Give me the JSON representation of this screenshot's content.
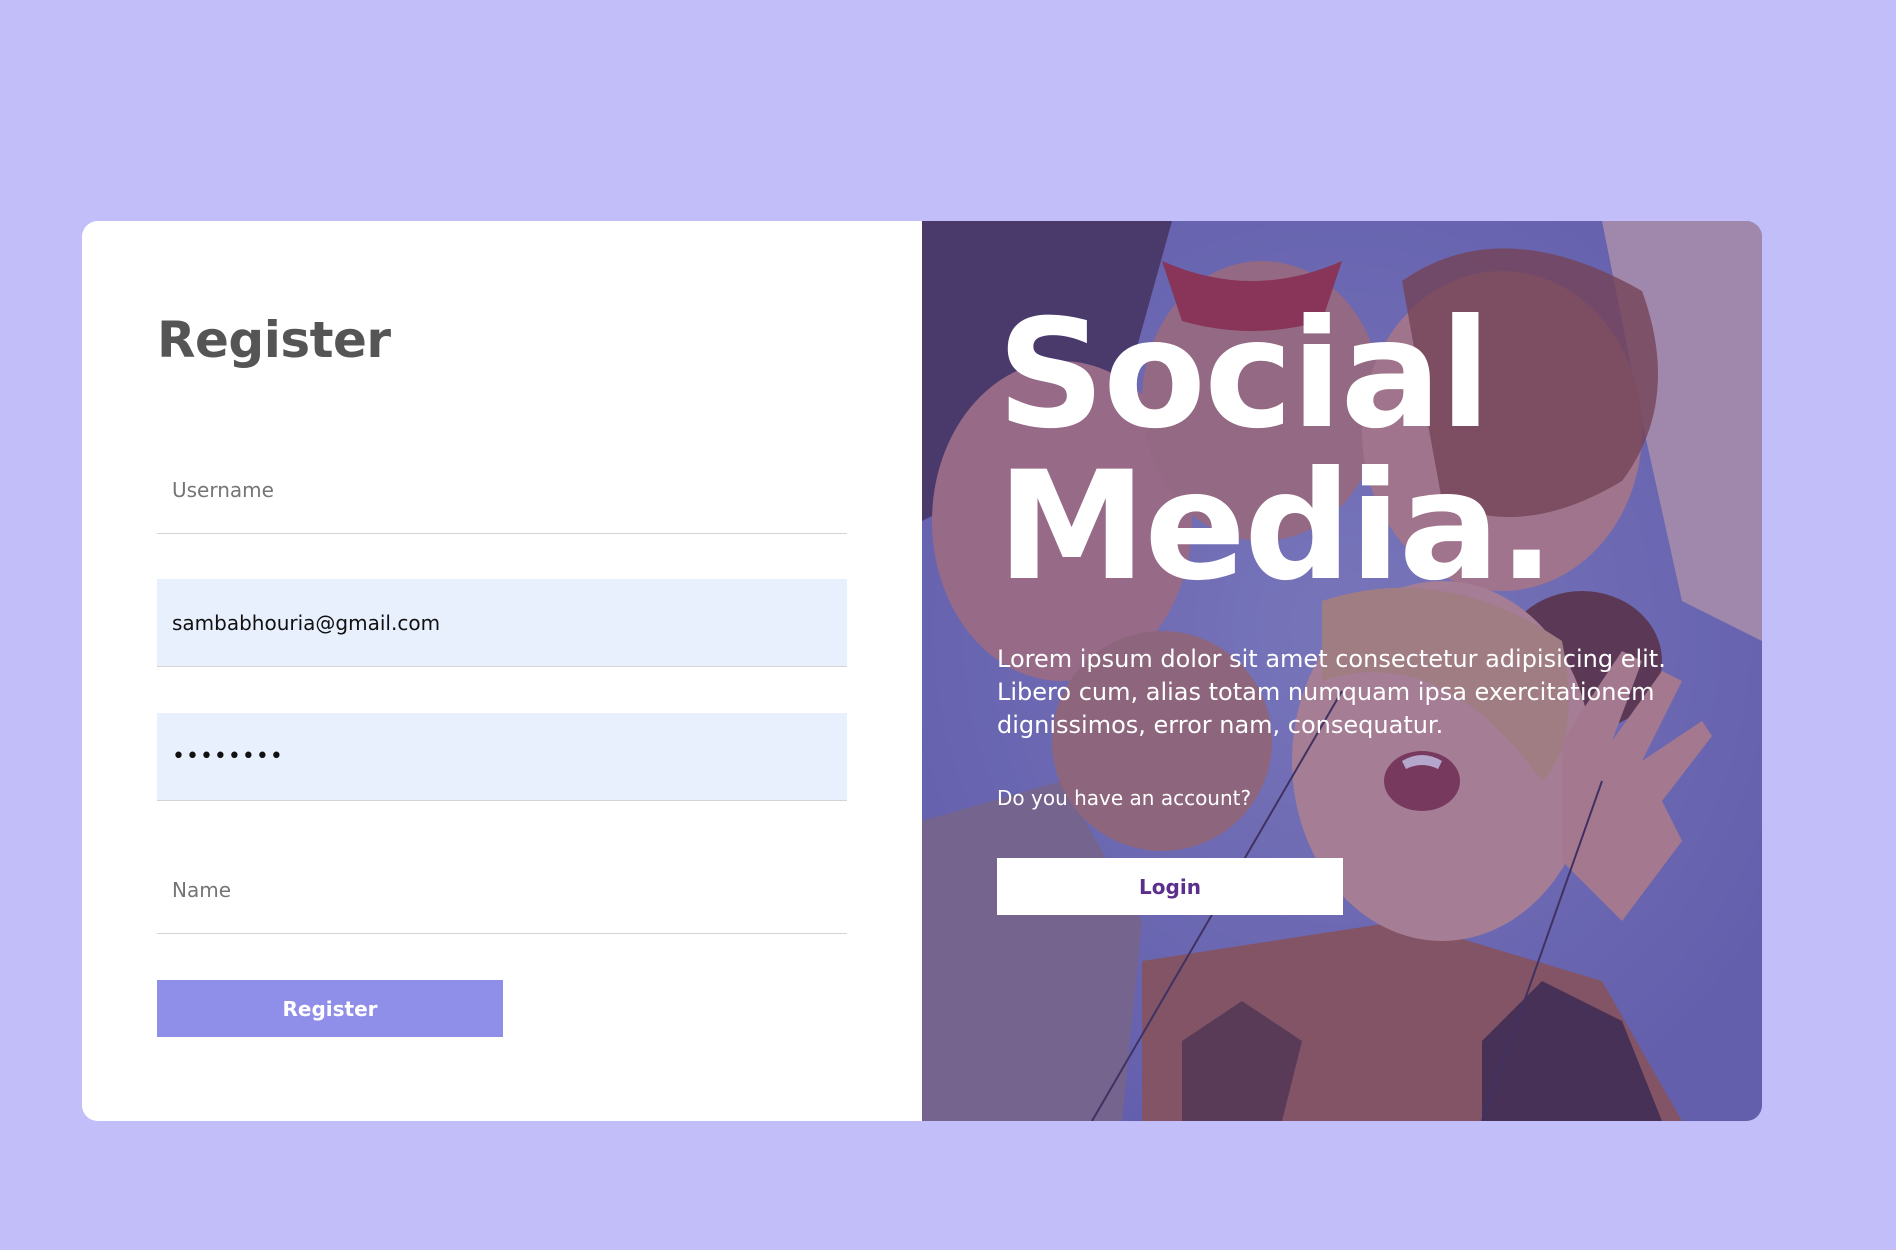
{
  "register_panel": {
    "title": "Register",
    "username": {
      "placeholder": "Username",
      "value": ""
    },
    "email": {
      "value": "sambabhouria@gmail.com"
    },
    "password": {
      "value": "••••••••"
    },
    "name": {
      "placeholder": "Name",
      "value": ""
    },
    "register_button": "Register"
  },
  "promo_panel": {
    "headline_line1": "Social",
    "headline_line2": "Media.",
    "description": "Lorem ipsum dolor sit amet consectetur adipisicing elit. Libero cum, alias totam numquam ipsa exercitationem dignissimos, error nam, consequatur.",
    "account_question": "Do you have an account?",
    "login_button": "Login",
    "background_image": "group-of-friends-photo"
  },
  "colors": {
    "page_background": "#c1befa",
    "register_button": "#8f8fe9",
    "filled_field": "#e8effd",
    "overlay": "#5c3a8c",
    "login_text": "#5b2f8c"
  }
}
